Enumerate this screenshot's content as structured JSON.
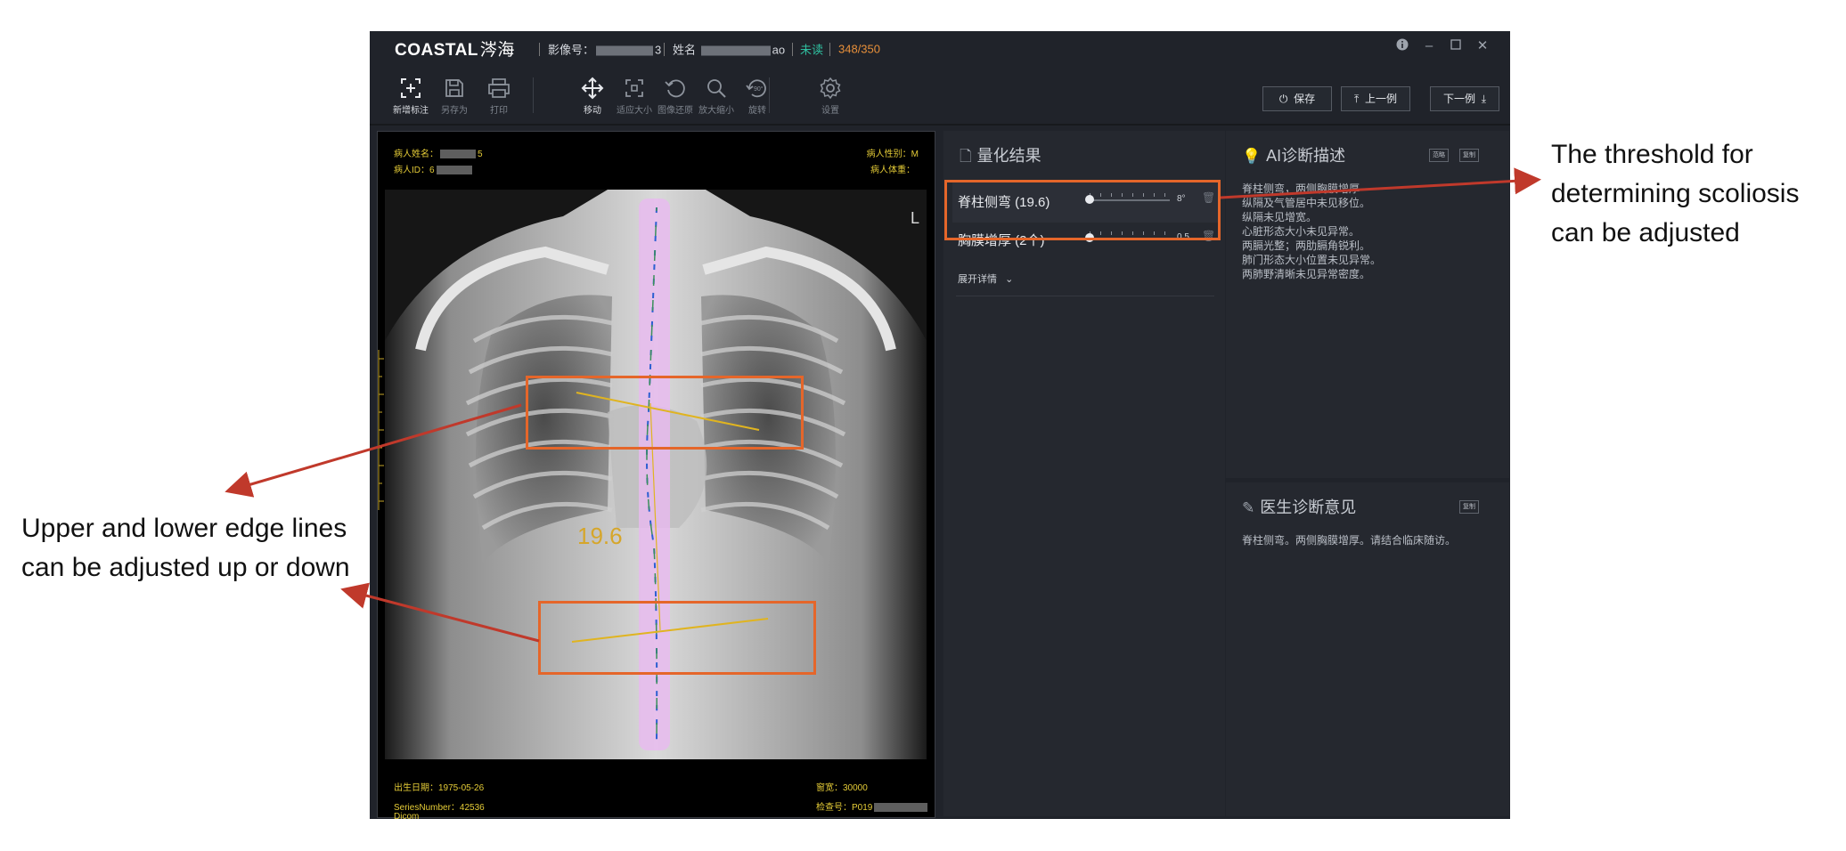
{
  "titlebar": {
    "brand": "COASTAL",
    "brand_cn": "涔海",
    "image_no_label": "影像号：",
    "image_no_tail": "3",
    "name_label": "姓名",
    "name_tail": "ao",
    "read_status": "未读",
    "progress": "348/350",
    "colors": {
      "read_status": "#2fc0a0",
      "progress": "#e8903a"
    }
  },
  "toolbar": {
    "tools": [
      {
        "label": "新增标注",
        "icon": "add-annotation-icon",
        "active": true
      },
      {
        "label": "另存为",
        "icon": "save-as-icon",
        "active": false
      },
      {
        "label": "打印",
        "icon": "print-icon",
        "active": false
      },
      {
        "label": "移动",
        "icon": "move-icon",
        "active": true
      },
      {
        "label": "适应大小",
        "icon": "fit-size-icon",
        "active": false
      },
      {
        "label": "图像还原",
        "icon": "restore-icon",
        "active": false
      },
      {
        "label": "放大缩小",
        "icon": "zoom-icon",
        "active": false
      },
      {
        "label": "旋转",
        "icon": "rotate-icon",
        "active": false
      },
      {
        "label": "设置",
        "icon": "settings-icon",
        "active": false
      }
    ],
    "save": "保存",
    "prev": "上一例",
    "next": "下一例"
  },
  "viewer": {
    "patient_name_label": "病人姓名：",
    "patient_name_tail": "5",
    "patient_id_label": "病人ID：",
    "patient_id_head": "6",
    "patient_sex": "病人性别：M",
    "patient_weight": "病人体重：",
    "birth_date": "出生日期：1975-05-26",
    "series_number": "SeriesNumber：42536",
    "modality": "Dicom",
    "window_width": "窗宽：30000",
    "exam_no": "检查号：P019",
    "angle_label": "19.6",
    "side_marker": "L"
  },
  "quant": {
    "title": "量化结果",
    "items": [
      {
        "name": "脊柱侧弯 (19.6)",
        "value": "8°",
        "fraction": 0.0
      },
      {
        "name": "胸膜增厚 (2个)",
        "value": "0.5",
        "fraction": 0.0
      }
    ],
    "expand": "展开详情"
  },
  "ai": {
    "title": "AI诊断描述",
    "btn1": "范略",
    "btn2": "复制",
    "text": "脊柱侧弯，两侧胸膜增厚\n纵隔及气管居中未见移位。\n纵隔未见增宽。\n心脏形态大小未见异常。\n两膈光整；两肋膈角锐利。\n肺门形态大小位置未见异常。\n两肺野清晰未见异常密度。"
  },
  "doctor": {
    "title": "医生诊断意见",
    "btn": "复制",
    "text": "脊柱侧弯。两侧胸膜增厚。请结合临床随访。"
  },
  "annotations": {
    "threshold": "The threshold for\ndetermining scoliosis\ncan be adjusted",
    "edges": "Upper and lower edge lines\ncan be adjusted up or down",
    "colors": {
      "box": "#e5662a",
      "arrow": "#c0392b"
    }
  }
}
